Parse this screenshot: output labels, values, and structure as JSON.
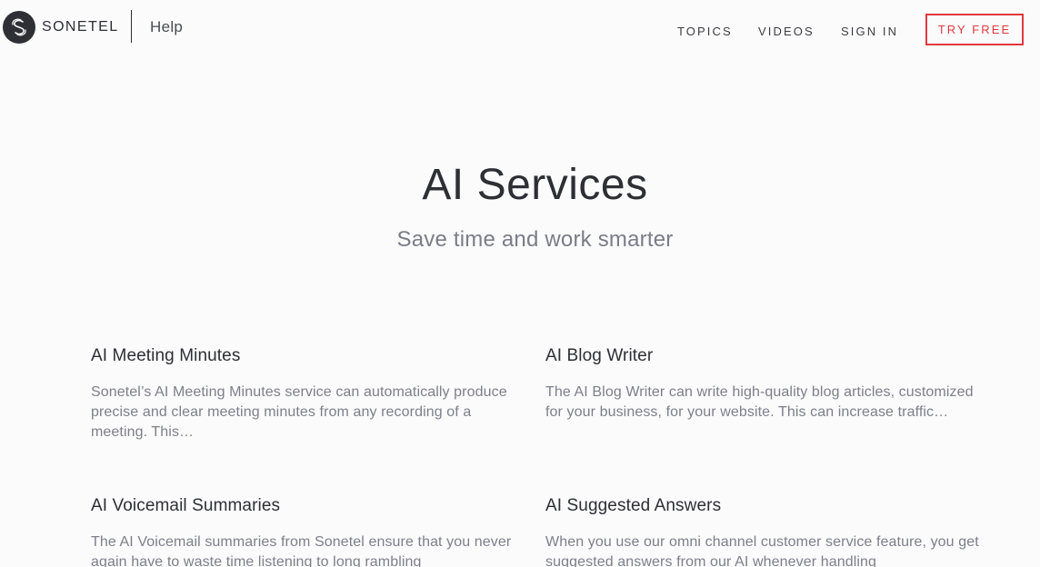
{
  "header": {
    "brand_name": "SONETEL",
    "help_label": "Help",
    "nav": {
      "topics": "TOPICS",
      "videos": "VIDEOS",
      "sign_in": "SIGN IN",
      "try_free": "TRY FREE"
    },
    "logo_icon": "sonetel-logo-icon"
  },
  "hero": {
    "title": "AI Services",
    "subtitle": "Save time and work smarter"
  },
  "articles": [
    {
      "title": "AI Meeting Minutes",
      "description": "Sonetel’s AI Meeting Minutes service can automatically produce precise and clear meeting minutes from any recording of a meeting. This…"
    },
    {
      "title": "AI Blog Writer",
      "description": "The AI Blog Writer can write high-quality blog articles, customized for your business, for your website. This can increase traffic…"
    },
    {
      "title": "AI Voicemail Summaries",
      "description": "The AI Voicemail summaries from Sonetel ensure that you never again have to waste time listening to long rambling"
    },
    {
      "title": "AI Suggested Answers",
      "description": "When you use our  omni channel customer service feature, you get suggested answers from our AI whenever handling"
    }
  ],
  "colors": {
    "accent": "#e0393e",
    "text": "#2e2f35",
    "muted": "#7e7f8a",
    "background": "#fbfbfc"
  }
}
